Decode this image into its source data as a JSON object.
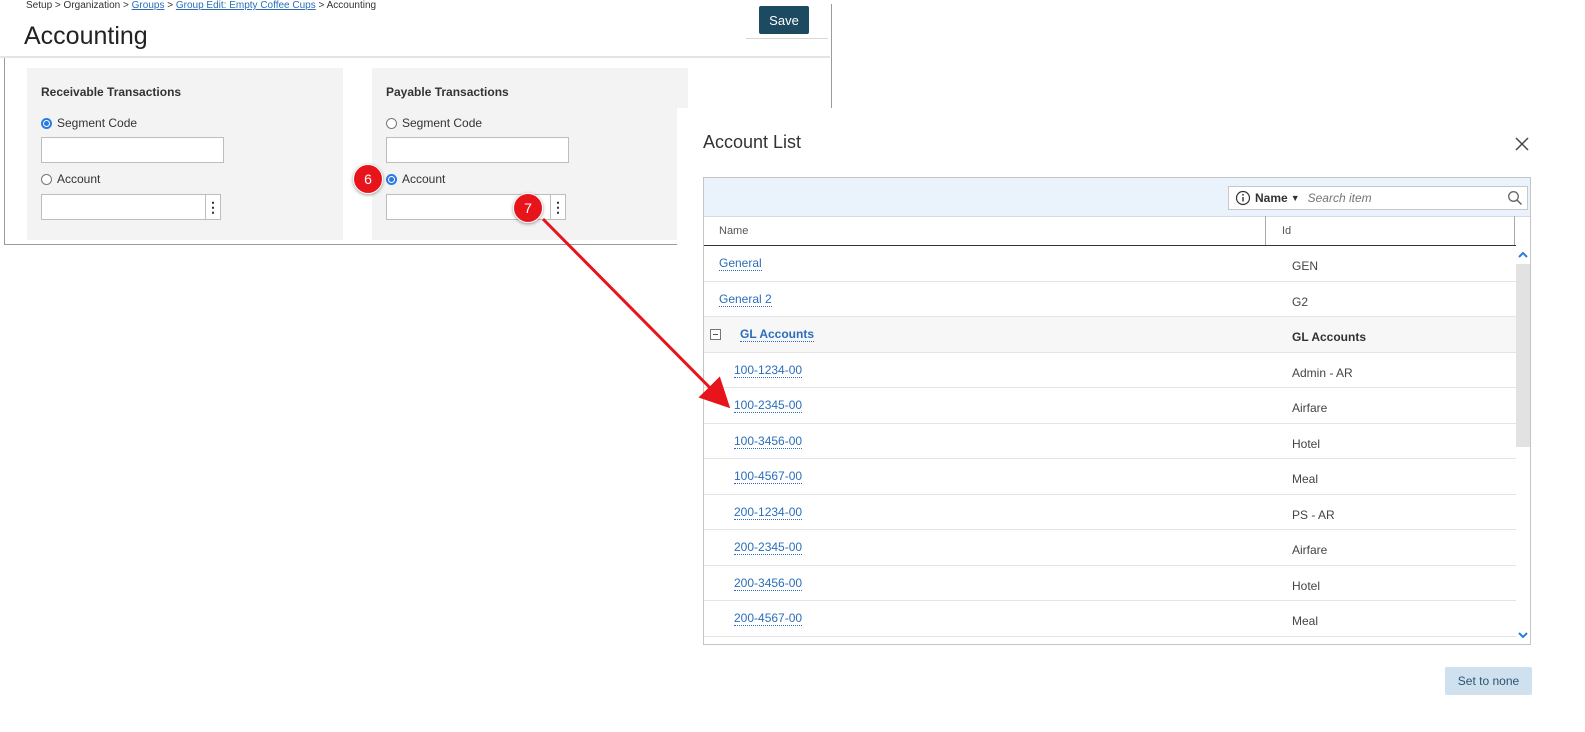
{
  "breadcrumb": {
    "setup": "Setup",
    "sep1": " > ",
    "organization": "Organization",
    "sep2": " > ",
    "groups": "Groups",
    "sep3": " > ",
    "group_edit": "Group Edit: Empty Coffee Cups",
    "sep4": " > ",
    "accounting": "Accounting"
  },
  "page": {
    "title": "Accounting",
    "save_label": "Save"
  },
  "receivable": {
    "title": "Receivable Transactions",
    "segment_code_label": "Segment Code",
    "account_label": "Account",
    "selected": "segment"
  },
  "payable": {
    "title": "Payable Transactions",
    "segment_code_label": "Segment Code",
    "account_label": "Account",
    "selected": "account"
  },
  "annotations": {
    "step6": "6",
    "step7": "7",
    "color": "#e8141c"
  },
  "modal": {
    "title": "Account List",
    "search": {
      "field_label": "Name",
      "placeholder": "Search item"
    },
    "columns": {
      "name": "Name",
      "id": "Id"
    },
    "rows": [
      {
        "name": "General",
        "id": "GEN",
        "type": "item",
        "indent": 0
      },
      {
        "name": "General 2",
        "id": "G2",
        "type": "item",
        "indent": 0
      },
      {
        "name": "GL Accounts",
        "id": "GL Accounts",
        "type": "group",
        "indent": 0
      },
      {
        "name": "100-1234-00",
        "id": "Admin - AR",
        "type": "item",
        "indent": 1
      },
      {
        "name": "100-2345-00",
        "id": "Airfare",
        "type": "item",
        "indent": 1
      },
      {
        "name": "100-3456-00",
        "id": "Hotel",
        "type": "item",
        "indent": 1
      },
      {
        "name": "100-4567-00",
        "id": "Meal",
        "type": "item",
        "indent": 1
      },
      {
        "name": "200-1234-00",
        "id": "PS - AR",
        "type": "item",
        "indent": 1
      },
      {
        "name": "200-2345-00",
        "id": "Airfare",
        "type": "item",
        "indent": 1
      },
      {
        "name": "200-3456-00",
        "id": "Hotel",
        "type": "item",
        "indent": 1
      },
      {
        "name": "200-4567-00",
        "id": "Meal",
        "type": "item",
        "indent": 1
      }
    ],
    "set_none_label": "Set to none"
  },
  "colors": {
    "accent": "#2a6ebb",
    "save_button": "#1c4a60",
    "radio_selected": "#2a7ae2",
    "toolbar_bg": "#eaf3fb",
    "set_none_bg": "#cfe0ee"
  },
  "icons": {
    "close": "close-icon",
    "info": "info-icon",
    "search": "search-icon",
    "lookup": "more-vertical-icon",
    "collapse": "collapse-icon",
    "scroll_up": "chevron-up-icon",
    "scroll_down": "chevron-down-icon"
  }
}
